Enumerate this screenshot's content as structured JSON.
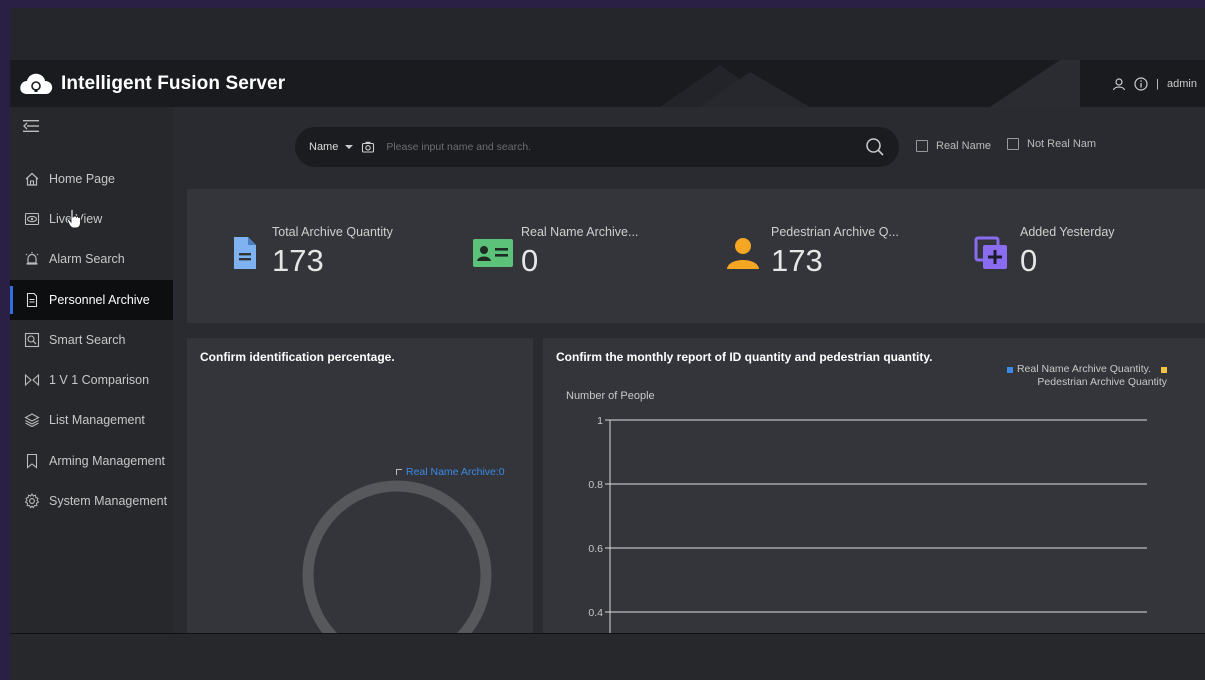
{
  "app": {
    "title": "Intelligent Fusion Server"
  },
  "header": {
    "user_label": "admin",
    "separator": "|"
  },
  "sidebar": {
    "items": [
      {
        "label": "Home Page",
        "icon": "home-icon",
        "active": false
      },
      {
        "label": "Live View",
        "icon": "eye-icon",
        "active": false
      },
      {
        "label": "Alarm Search",
        "icon": "alarm-icon",
        "active": false
      },
      {
        "label": "Personnel Archive",
        "icon": "document-icon",
        "active": true
      },
      {
        "label": "Smart Search",
        "icon": "smart-search-icon",
        "active": false
      },
      {
        "label": "1 V 1 Comparison",
        "icon": "compare-icon",
        "active": false
      },
      {
        "label": "List Management",
        "icon": "layers-icon",
        "active": false
      },
      {
        "label": "Arming Management",
        "icon": "bookmark-icon",
        "active": false
      },
      {
        "label": "System Management",
        "icon": "gear-icon",
        "active": false
      }
    ]
  },
  "search": {
    "type_label": "Name",
    "placeholder": "Please input name and search.",
    "value": ""
  },
  "filters": {
    "real_name": "Real Name",
    "not_real_name": "Not Real Nam"
  },
  "stats": [
    {
      "label": "Total Archive Quantity",
      "value": "173",
      "icon": "file-icon",
      "color": "#7fb2f0"
    },
    {
      "label": "Real Name Archive...",
      "value": "0",
      "icon": "id-card-icon",
      "color": "#5cc27a"
    },
    {
      "label": "Pedestrian Archive Q...",
      "value": "173",
      "icon": "person-icon",
      "color": "#f5a623"
    },
    {
      "label": "Added Yesterday",
      "value": "0",
      "icon": "add-copy-icon",
      "color": "#8a6cf0"
    }
  ],
  "pie_panel": {
    "title": "Confirm identification percentage.",
    "legend": "Real Name Archive:0"
  },
  "line_panel": {
    "title": "Confirm the monthly report of ID quantity and pedestrian quantity.",
    "legend": [
      {
        "name": "Real Name Archive Quantity.",
        "color": "#3b8be6"
      },
      {
        "name": "Pedestrian Archive Quantity",
        "color": "#f5c242"
      }
    ]
  },
  "chart_data": {
    "type": "line",
    "title": "Confirm the monthly report of ID quantity and pedestrian quantity.",
    "ylabel": "Number of People",
    "yticks": [
      "1",
      "0.8",
      "0.6",
      "0.4"
    ],
    "ylim": [
      0,
      1
    ],
    "grid": true,
    "legend_position": "top-right",
    "series": [
      {
        "name": "Real Name Archive Quantity.",
        "values": []
      },
      {
        "name": "Pedestrian Archive Quantity",
        "values": []
      }
    ]
  }
}
